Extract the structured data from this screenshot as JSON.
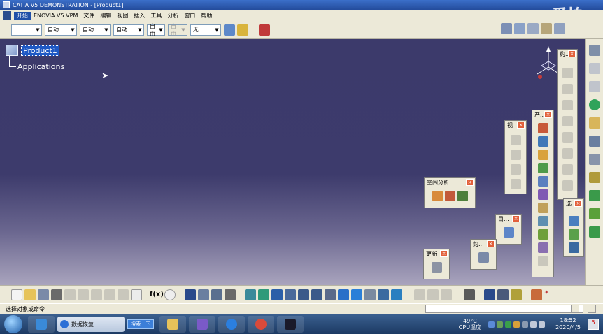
{
  "window": {
    "title": "CATIA V5 DEMONSTRATION - [Product1]",
    "watermark": "爱拍"
  },
  "menu": {
    "items": [
      "开始",
      "ENOVIA V5 VPM",
      "文件",
      "编辑",
      "视图",
      "插入",
      "工具",
      "分析",
      "窗口",
      "帮助"
    ]
  },
  "toolbar": {
    "combo_line": "",
    "combo_color": "自动",
    "combo_thickness": "自动",
    "combo_linetype": "自动",
    "combo_layer": "自动",
    "combo_renderstyle": "自由",
    "combo_grayed": "自由",
    "combo_none": "无"
  },
  "tree": {
    "root": "Product1",
    "child": "Applications"
  },
  "panels": {
    "space_analysis": {
      "title": "空间分析"
    },
    "update": {
      "title": "更新"
    },
    "directory": {
      "title": "目..."
    },
    "constraint": {
      "title": "约..."
    },
    "view": {
      "title": "视"
    },
    "product_tools": {
      "title": "产..."
    },
    "tools": {
      "title": "选"
    },
    "tall": {
      "title": "约..."
    }
  },
  "status": {
    "message": "选择对象或命令"
  },
  "taskbar": {
    "task_label": "数据恢复",
    "search_label": "搜索一下",
    "temperature": "49°C",
    "cpu_label": "CPU温度",
    "time": "18:52",
    "date": "2020/4/5",
    "notification_count": "5"
  },
  "colors": {
    "canvas_top": "#3c3a6b",
    "canvas_bottom": "#a9a4bd",
    "selection": "#1f59c4",
    "close_button": "#e2603a"
  }
}
